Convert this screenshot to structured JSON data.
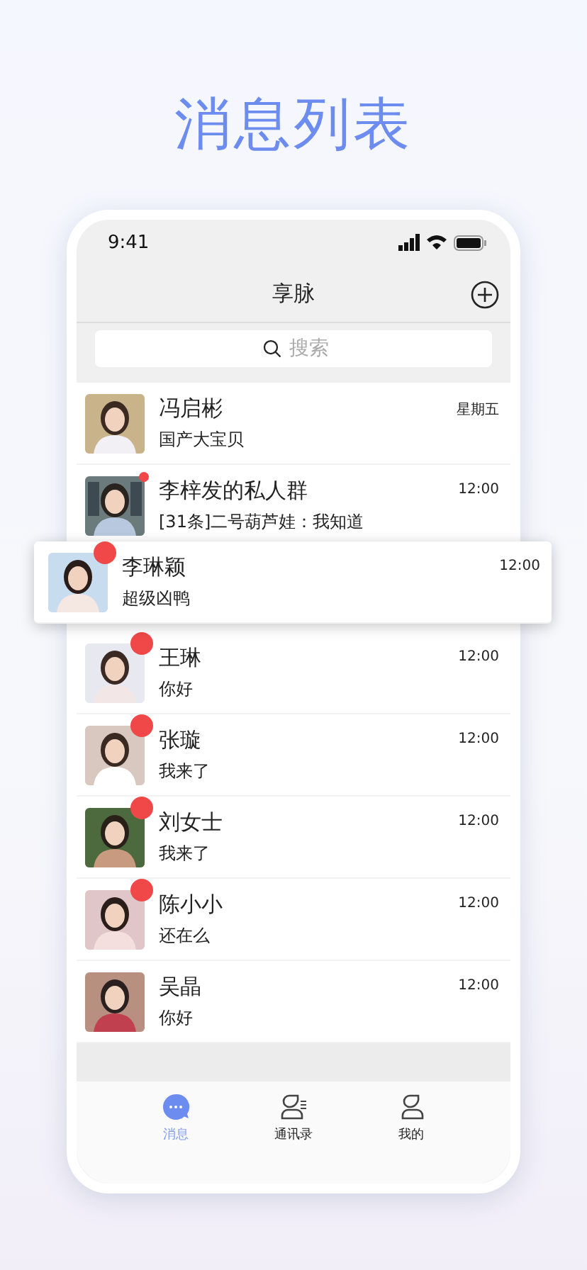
{
  "headline": "消息列表",
  "status_bar": {
    "time": "9:41"
  },
  "nav": {
    "title": "享脉"
  },
  "search": {
    "placeholder": "搜索"
  },
  "chats": [
    {
      "name": "冯启彬",
      "message": "国产大宝贝",
      "time": "星期五",
      "kind": "person",
      "unread": false,
      "featured": false
    },
    {
      "name": "李梓发的私人群",
      "message": "[31条]二号葫芦娃：我知道",
      "time": "12:00",
      "kind": "group",
      "unread": true,
      "featured": false
    },
    {
      "name": "李琳颖",
      "message": "超级凶鸭",
      "time": "12:00",
      "kind": "person",
      "unread": true,
      "featured": true
    },
    {
      "name": "王琳",
      "message": "你好",
      "time": "12:00",
      "kind": "person",
      "unread": true,
      "featured": false
    },
    {
      "name": "张璇",
      "message": "我来了",
      "time": "12:00",
      "kind": "person",
      "unread": true,
      "featured": false
    },
    {
      "name": "刘女士",
      "message": "我来了",
      "time": "12:00",
      "kind": "person",
      "unread": true,
      "featured": false
    },
    {
      "name": "陈小小",
      "message": "还在么",
      "time": "12:00",
      "kind": "person",
      "unread": true,
      "featured": false
    },
    {
      "name": "吴晶",
      "message": "你好",
      "time": "12:00",
      "kind": "person",
      "unread": false,
      "featured": false
    }
  ],
  "tabs": [
    {
      "label": "消息",
      "kind": "chat",
      "selected": true
    },
    {
      "label": "通讯录",
      "kind": "contacts",
      "selected": false
    },
    {
      "label": "我的",
      "kind": "profile",
      "selected": false
    }
  ]
}
